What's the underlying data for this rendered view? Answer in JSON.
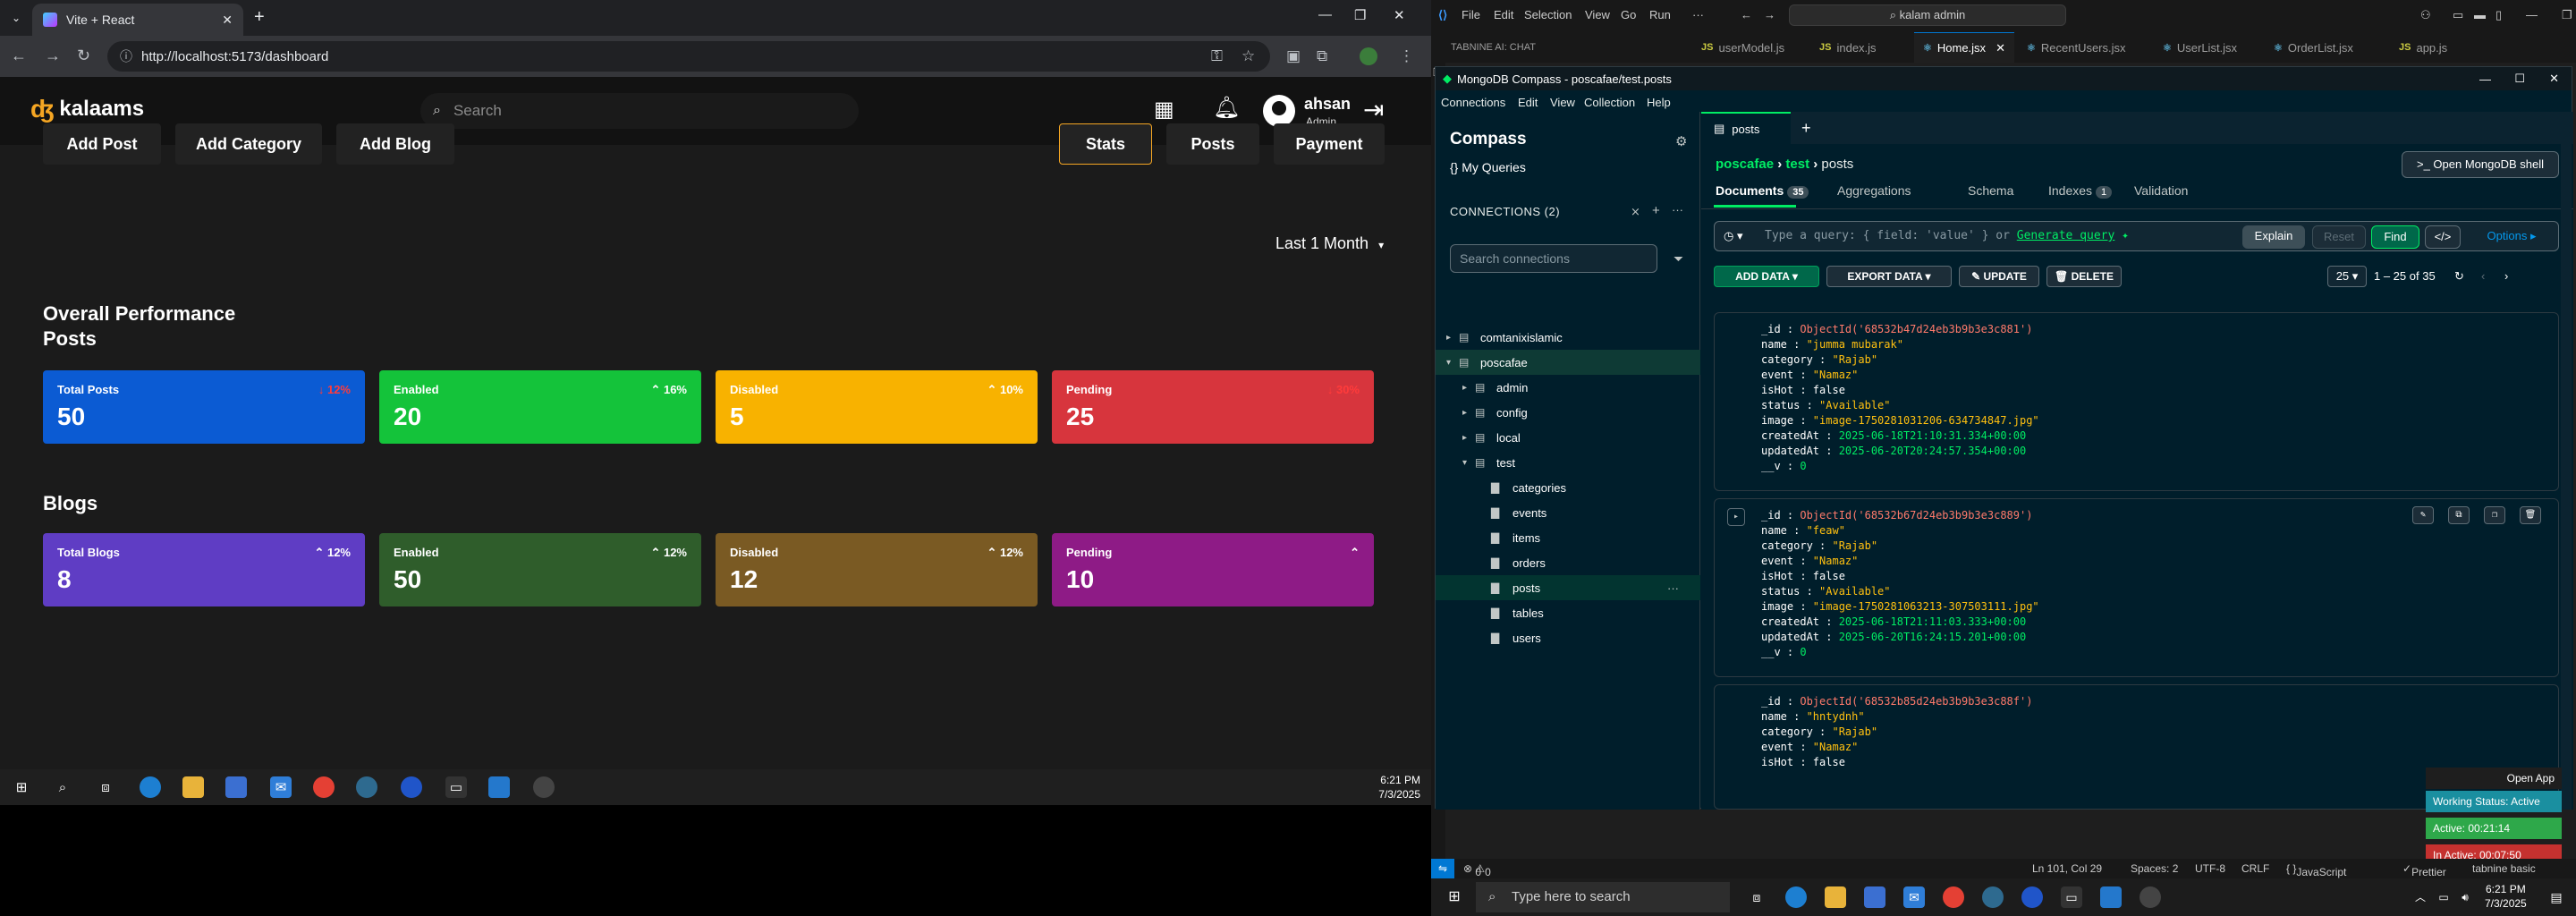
{
  "browser": {
    "tab_title": "Vite + React",
    "url": "http://localhost:5173/dashboard"
  },
  "app": {
    "logo": "kalaams",
    "search_placeholder": "Search",
    "user_name": "ahsan",
    "user_role": "Admin",
    "left_actions": [
      "Add Post",
      "Add Category",
      "Add Blog"
    ],
    "right_tabs": [
      "Stats",
      "Posts",
      "Payment"
    ],
    "selected_tab": "Stats",
    "overall_title": "Overall Performance",
    "posts_title": "Posts",
    "blogs_title": "Blogs",
    "period": "Last 1 Month",
    "posts_cards": [
      {
        "label": "Total Posts",
        "value": "50",
        "pct": "12%",
        "trend": "down",
        "color": "#0b5bd3"
      },
      {
        "label": "Enabled",
        "value": "20",
        "pct": "16%",
        "trend": "up",
        "color": "#14c33a"
      },
      {
        "label": "Disabled",
        "value": "5",
        "pct": "10%",
        "trend": "up",
        "color": "#f8b200"
      },
      {
        "label": "Pending",
        "value": "25",
        "pct": "30%",
        "trend": "down",
        "color": "#d7353d"
      }
    ],
    "blogs_cards": [
      {
        "label": "Total Blogs",
        "value": "8",
        "pct": "12%",
        "trend": "up",
        "color": "#5f3dc4"
      },
      {
        "label": "Enabled",
        "value": "50",
        "pct": "12%",
        "trend": "up",
        "color": "#2f5d2b"
      },
      {
        "label": "Disabled",
        "value": "12",
        "pct": "12%",
        "trend": "up",
        "color": "#7a5a23"
      },
      {
        "label": "Pending",
        "value": "10",
        "pct": "",
        "trend": "up",
        "color": "#8e1b86"
      }
    ]
  },
  "taskbar_left": {
    "time": "6:21 PM",
    "date": "7/3/2025"
  },
  "vscode": {
    "menu": [
      "File",
      "Edit",
      "Selection",
      "View",
      "Go",
      "Run",
      "···"
    ],
    "search": "kalam admin",
    "tabs": [
      {
        "label": "TABNINE AI: CHAT",
        "kind": "chat"
      },
      {
        "label": "userModel.js",
        "kind": "js"
      },
      {
        "label": "index.js",
        "kind": "js"
      },
      {
        "label": "Home.jsx",
        "kind": "jsx",
        "active": true
      },
      {
        "label": "RecentUsers.jsx",
        "kind": "jsx"
      },
      {
        "label": "UserList.jsx",
        "kind": "jsx"
      },
      {
        "label": "OrderList.jsx",
        "kind": "jsx"
      },
      {
        "label": "app.js",
        "kind": "js"
      }
    ],
    "status": {
      "errors": "0",
      "warnings": "0",
      "position": "Ln 101, Col 29",
      "spaces": "Spaces: 2",
      "encoding": "UTF-8",
      "eol": "CRLF",
      "language": "JavaScript JSX",
      "prettier": "Prettier",
      "tabnine": "tabnine basic"
    }
  },
  "compass": {
    "title": "MongoDB Compass - poscafae/test.posts",
    "menu": [
      "Connections",
      "Edit",
      "View",
      "Collection",
      "Help"
    ],
    "brand": "Compass",
    "my_queries": "My Queries",
    "connections_label": "CONNECTIONS (2)",
    "search_placeholder": "Search connections",
    "tree": [
      {
        "label": "comtanixislamic",
        "level": 0,
        "type": "conn",
        "caret": "▸"
      },
      {
        "label": "poscafae",
        "level": 0,
        "type": "conn",
        "caret": "▾",
        "sel": "parent"
      },
      {
        "label": "admin",
        "level": 1,
        "type": "db",
        "caret": "▸"
      },
      {
        "label": "config",
        "level": 1,
        "type": "db",
        "caret": "▸"
      },
      {
        "label": "local",
        "level": 1,
        "type": "db",
        "caret": "▸"
      },
      {
        "label": "test",
        "level": 1,
        "type": "db",
        "caret": "▾"
      },
      {
        "label": "categories",
        "level": 2,
        "type": "coll"
      },
      {
        "label": "events",
        "level": 2,
        "type": "coll"
      },
      {
        "label": "items",
        "level": 2,
        "type": "coll"
      },
      {
        "label": "orders",
        "level": 2,
        "type": "coll"
      },
      {
        "label": "posts",
        "level": 2,
        "type": "coll",
        "sel": "self"
      },
      {
        "label": "tables",
        "level": 2,
        "type": "coll"
      },
      {
        "label": "users",
        "level": 2,
        "type": "coll"
      }
    ],
    "open_tab": "posts",
    "crumb": {
      "conn": "poscafae",
      "db": "test",
      "coll": "posts"
    },
    "shell_button": "Open MongoDB shell",
    "subtabs": [
      {
        "label": "Documents",
        "badge": "35",
        "on": true
      },
      {
        "label": "Aggregations",
        "badge": ""
      },
      {
        "label": "Schema",
        "badge": ""
      },
      {
        "label": "Indexes",
        "badge": "1"
      },
      {
        "label": "Validation",
        "badge": ""
      }
    ],
    "query_placeholder": "Type a query: { field: 'value' } or",
    "generate_query": "Generate query",
    "explain": "Explain",
    "reset": "Reset",
    "find": "Find",
    "options": "Options",
    "add_data": "ADD DATA",
    "export_data": "EXPORT DATA",
    "update": "UPDATE",
    "delete": "DELETE",
    "page_size": "25",
    "page_range": "1 – 25 of 35",
    "documents": [
      {
        "_id": "ObjectId('68532b47d24eb3b9b3e3c881')",
        "name": "\"jumma mubarak\"",
        "category": "\"Rajab\"",
        "event": "\"Namaz\"",
        "isHot": "false",
        "status": "\"Available\"",
        "image": "\"image-1750281031206-634734847.jpg\"",
        "createdAt": "2025-06-18T21:10:31.334+00:00",
        "updatedAt": "2025-06-20T20:24:57.354+00:00",
        "__v": "0"
      },
      {
        "_id": "ObjectId('68532b67d24eb3b9b3e3c889')",
        "name": "\"feaw\"",
        "category": "\"Rajab\"",
        "event": "\"Namaz\"",
        "isHot": "false",
        "status": "\"Available\"",
        "image": "\"image-1750281063213-307503111.jpg\"",
        "createdAt": "2025-06-18T21:11:03.333+00:00",
        "updatedAt": "2025-06-20T16:24:15.201+00:00",
        "__v": "0"
      },
      {
        "_id": "ObjectId('68532b85d24eb3b9b3e3c88f')",
        "name": "\"hntydnh\"",
        "category": "\"Rajab\"",
        "event": "\"Namaz\"",
        "isHot": "false"
      }
    ],
    "tabnine_panel": {
      "open_app": "Open App",
      "working": "Working Status: Active",
      "active": "Active: 00:21:14",
      "inactive": "In Active: 00:07:50"
    }
  },
  "taskbar_right": {
    "search_placeholder": "Type here to search",
    "time": "6:21 PM",
    "date": "7/3/2025"
  }
}
